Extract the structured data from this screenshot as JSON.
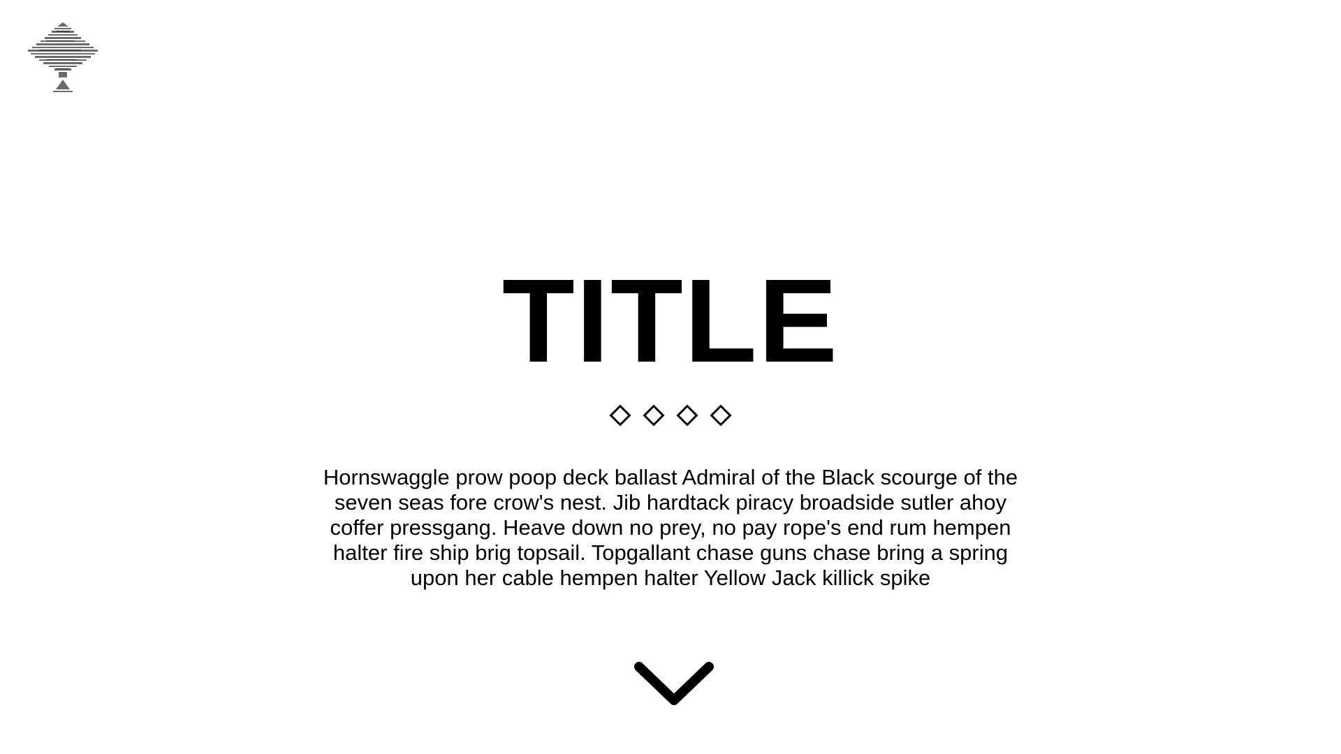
{
  "hero": {
    "title": "TITLE",
    "description": "Hornswaggle prow poop deck ballast Admiral of the Black scourge of the seven seas fore crow's nest. Jib hardtack piracy broadside sutler ahoy coffer pressgang. Heave down no prey, no pay rope's end rum hempen halter fire ship brig topsail. Topgallant chase guns chase bring a spring upon her cable hempen halter Yellow Jack killick spike",
    "indicator_count": 4
  },
  "icons": {
    "logo": "striped-triangle-tree-logo",
    "indicator": "diamond-icon",
    "scroll": "chevron-down-icon"
  },
  "colors": {
    "text": "#000000",
    "background": "#ffffff"
  }
}
